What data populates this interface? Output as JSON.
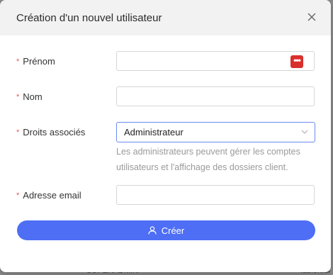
{
  "background": {
    "fragments": [
      "SUPERADMIN",
      "fabien.di"
    ]
  },
  "modal": {
    "title": "Création d'un nouvel utilisateur"
  },
  "form": {
    "firstname_label": "Prénom",
    "firstname_value": "",
    "lastname_label": "Nom",
    "lastname_value": "",
    "rights_label": "Droits associés",
    "rights_value": "Administrateur",
    "rights_hint": "Les administrateurs peuvent gérer les comptes utilisateurs et l'affichage des dossiers client.",
    "email_label": "Adresse email",
    "email_value": "",
    "required_marker": "*",
    "password_manager_glyph": "•••"
  },
  "actions": {
    "submit_label": "Créer"
  },
  "colors": {
    "accent": "#4e6ef5",
    "required": "#e05a5a",
    "header_bg": "#f2f2f3"
  }
}
